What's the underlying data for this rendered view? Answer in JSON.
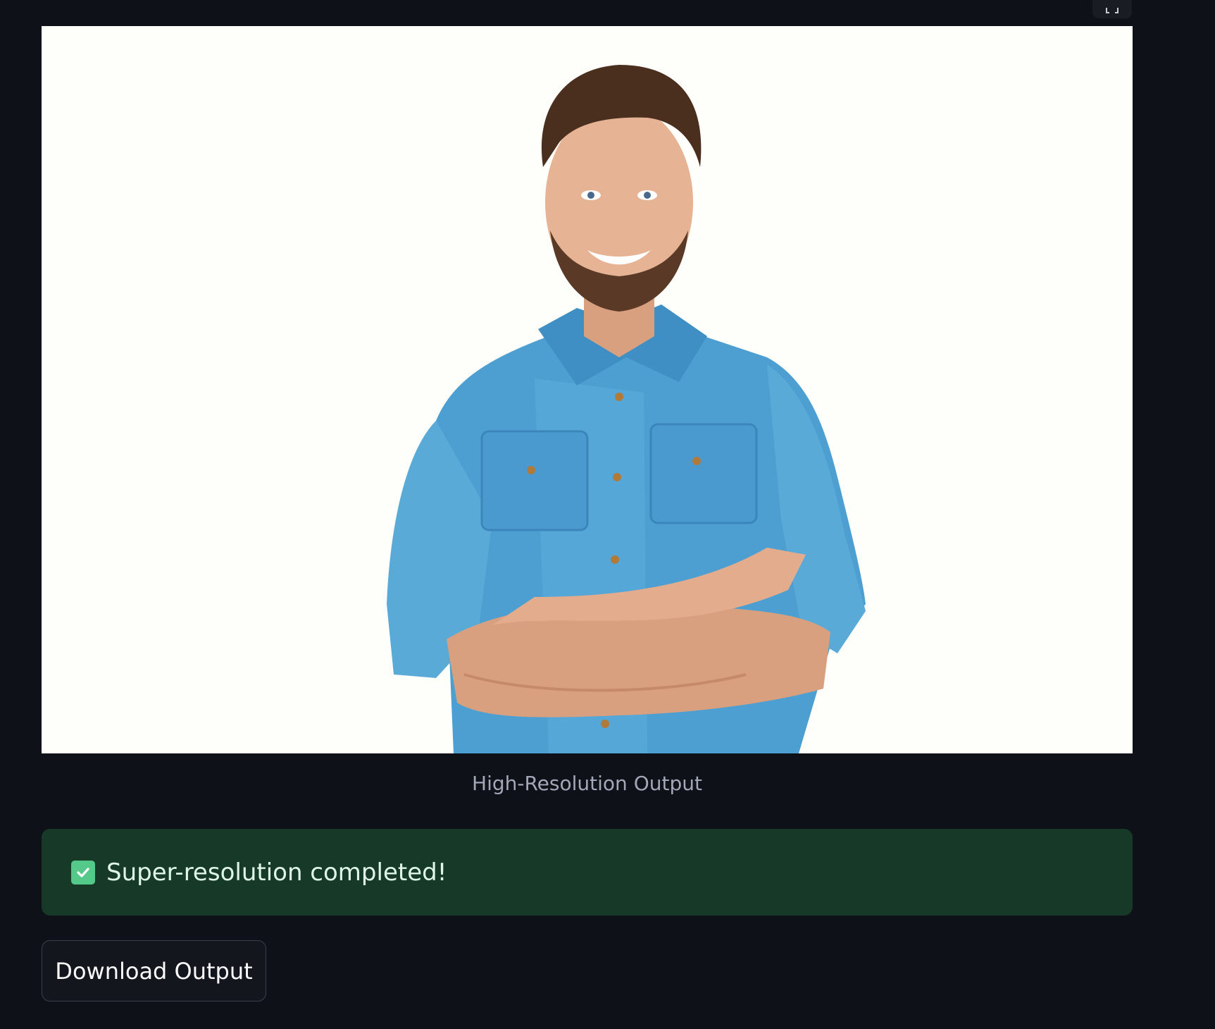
{
  "output": {
    "image_alt": "Smiling man in denim shirt with arms crossed",
    "caption": "High-Resolution Output"
  },
  "status": {
    "icon": "check-box-icon",
    "message": "Super-resolution completed!",
    "color": "#173928"
  },
  "actions": {
    "download_label": "Download Output"
  },
  "colors": {
    "background": "#0e1117",
    "image_background": "#fefefb",
    "success_bg": "#173928",
    "check_green": "#54c98a"
  }
}
